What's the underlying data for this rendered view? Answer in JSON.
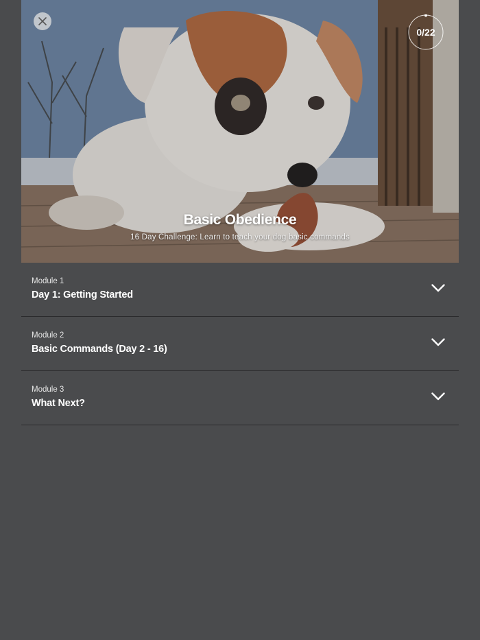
{
  "hero": {
    "title": "Basic Obedience",
    "subtitle": "16 Day Challenge: Learn to teach your dog basic commands",
    "image_icon": "puppy-photo",
    "progress": {
      "text": "0/22",
      "completed": 0,
      "total": 22
    },
    "close_icon": "close-icon"
  },
  "modules": [
    {
      "label": "Module 1",
      "title": "Day 1: Getting Started",
      "icon": "chevron-down-icon"
    },
    {
      "label": "Module 2",
      "title": "Basic Commands (Day 2 - 16)",
      "icon": "chevron-down-icon"
    },
    {
      "label": "Module 3",
      "title": "What Next?",
      "icon": "chevron-down-icon"
    }
  ],
  "colors": {
    "background": "#4a4b4d",
    "divider": "#2a2a2c",
    "text": "#ffffff"
  }
}
